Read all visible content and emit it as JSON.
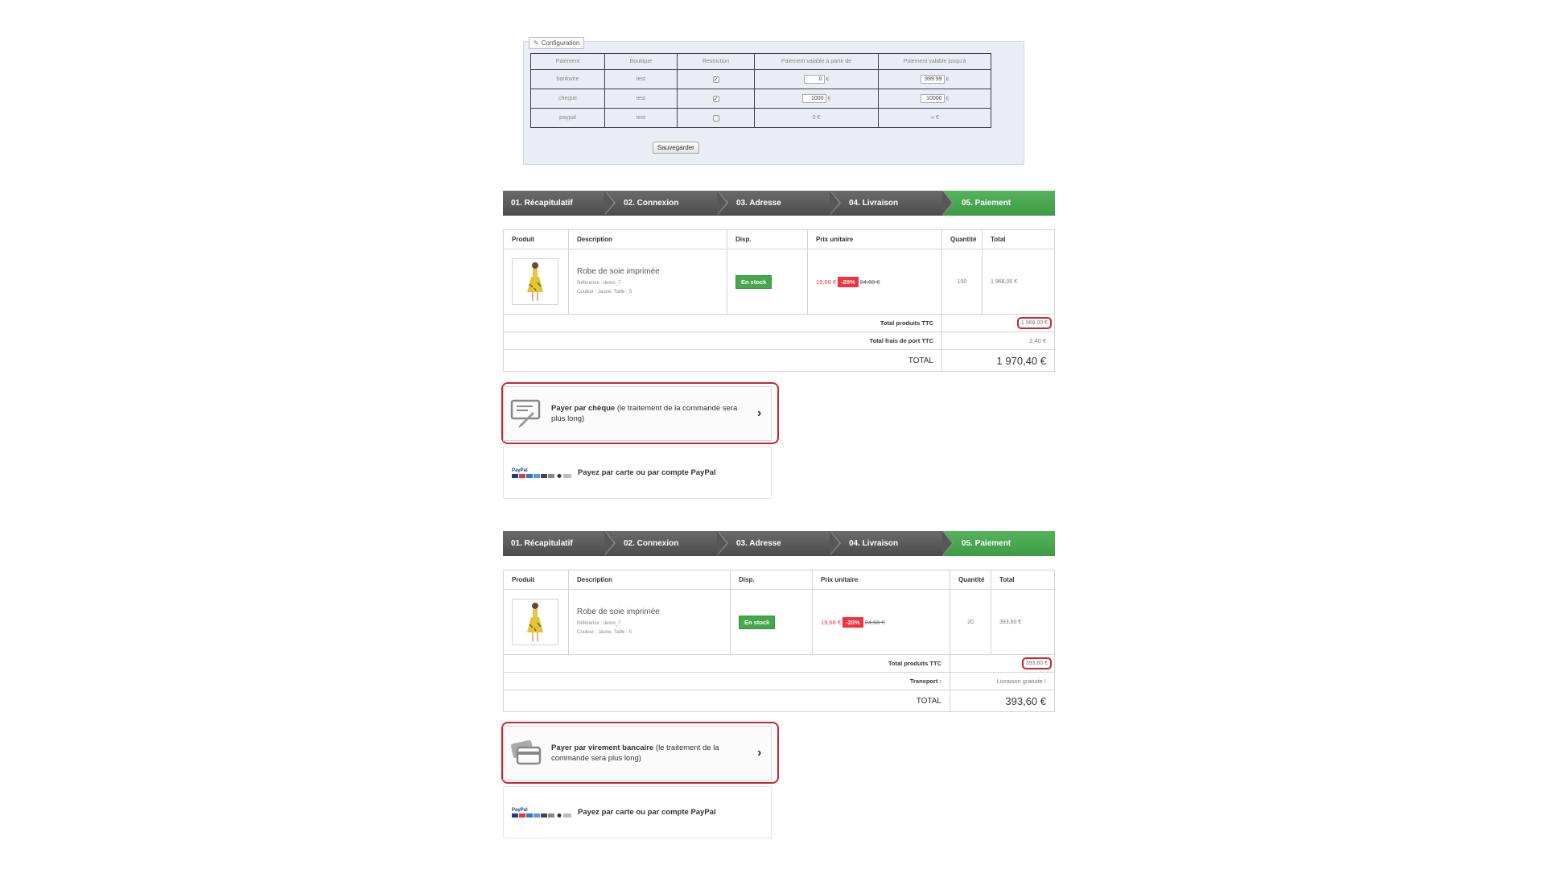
{
  "config": {
    "legend": "Configuration",
    "headers": [
      "Paiement",
      "Boutique",
      "Restriction",
      "Paiement valable à partir de",
      "Paiement valable jusqu'à"
    ],
    "rows": [
      {
        "payment": "bankwire",
        "shop": "test",
        "restricted": true,
        "from": "0",
        "to": "999.99",
        "currency": "€"
      },
      {
        "payment": "cheque",
        "shop": "test",
        "restricted": true,
        "from": "1000",
        "to": "10000",
        "currency": "€"
      },
      {
        "payment": "paypal",
        "shop": "test",
        "restricted": false,
        "from_text": "0 €",
        "to_text": "∞ €"
      }
    ],
    "save_label": "Sauvegarder"
  },
  "steps": [
    "01. Récapitulatif",
    "02. Connexion",
    "03. Adresse",
    "04. Livraison",
    "05. Paiement"
  ],
  "cart_headers": [
    "Produit",
    "Description",
    "Disp.",
    "Prix unitaire",
    "Quantité",
    "Total"
  ],
  "cart1": {
    "product_name": "Robe de soie imprimée",
    "reference": "Référence : demo_7",
    "attributes": "Couleur : Jaune, Taille : S",
    "availability": "En stock",
    "price_new": "19,68 €",
    "discount": "-20%",
    "price_old": "24,60 €",
    "quantity": "100",
    "line_total": "1 968,00 €",
    "total_products_label": "Total produits TTC",
    "total_products": "1 968,00 €",
    "shipping_label": "Total frais de port TTC",
    "shipping": "2,40 €",
    "total_label": "TOTAL",
    "total": "1 970,40 €"
  },
  "cart2": {
    "product_name": "Robe de soie imprimée",
    "reference": "Référence : demo_7",
    "attributes": "Couleur : Jaune, Taille : S",
    "availability": "En stock",
    "price_new": "19,68 €",
    "discount": "-20%",
    "price_old": "24,60 €",
    "quantity": "20",
    "line_total": "393,60 €",
    "total_products_label": "Total produits TTC",
    "total_products": "393,60 €",
    "shipping_label": "Transport :",
    "shipping": "Livraison gratuite !",
    "total_label": "TOTAL",
    "total": "393,60 €"
  },
  "payment1": {
    "cheque_bold": "Payer par chèque",
    "cheque_rest": " (le traitement de la commande sera plus long)",
    "paypal_label": "Payez par carte ou par compte PayPal"
  },
  "payment2": {
    "bankwire_bold": "Payer par virement bancaire",
    "bankwire_rest": " (le traitement de la commande sera plus long)",
    "paypal_label": "Payez par carte ou par compte PayPal"
  },
  "colors": {
    "step_active": "#46a74e",
    "step_inactive": "#5a5a5a",
    "highlight_red": "#c9252c",
    "price_red": "#f13340"
  },
  "icons": [
    "wrench-icon",
    "cheque-icon",
    "credit-card-icon",
    "paypal-logo",
    "chevron-right-icon",
    "checkbox-icon",
    "dress-thumbnail"
  ]
}
